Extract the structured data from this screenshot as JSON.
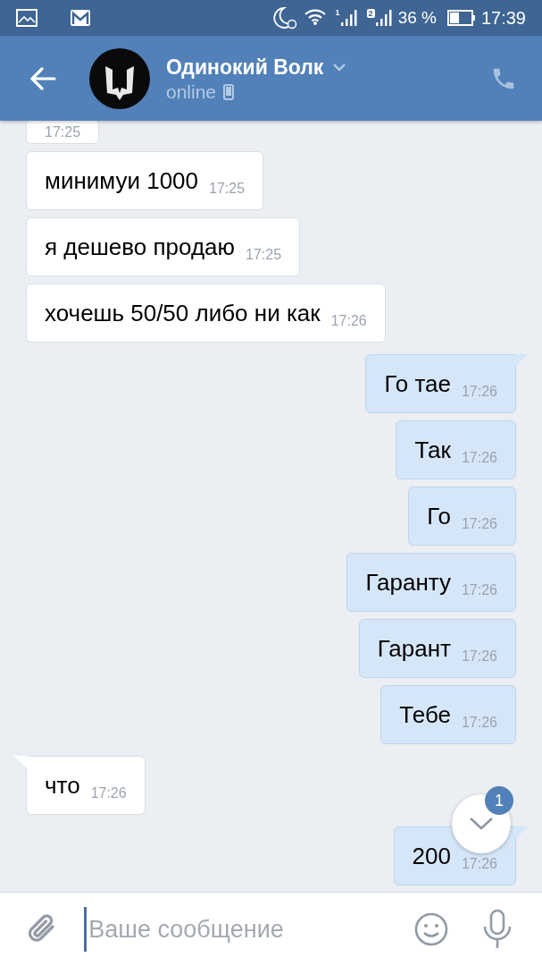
{
  "status_bar": {
    "battery": "36 %",
    "time": "17:39",
    "sim_1": "1",
    "sim_2": "2"
  },
  "header": {
    "name": "Одинокий Волк",
    "status": "online"
  },
  "messages": [
    {
      "kind": "in",
      "time": "17:25",
      "tail": false
    },
    {
      "kind": "in",
      "text": "минимуи 1000",
      "time": "17:25",
      "tail": false
    },
    {
      "kind": "in",
      "text": "я дешево продаю",
      "time": "17:25",
      "tail": false
    },
    {
      "kind": "in",
      "text": "хочешь 50/50 либо ни как",
      "time": "17:26",
      "tail": false
    },
    {
      "kind": "out",
      "text": "Го тае",
      "time": "17:26",
      "tail": true
    },
    {
      "kind": "out",
      "text": "Так",
      "time": "17:26",
      "tail": false
    },
    {
      "kind": "out",
      "text": "Го",
      "time": "17:26",
      "tail": false
    },
    {
      "kind": "out",
      "text": "Гаранту",
      "time": "17:26",
      "tail": false
    },
    {
      "kind": "out",
      "text": "Гарант",
      "time": "17:26",
      "tail": false
    },
    {
      "kind": "out",
      "text": "Тебе",
      "time": "17:26",
      "tail": false
    },
    {
      "kind": "in",
      "text": "что",
      "time": "17:26",
      "tail": true
    },
    {
      "kind": "out",
      "text": "200",
      "time": "17:26",
      "tail": true
    }
  ],
  "scroll_down": {
    "badge": "1"
  },
  "composer": {
    "placeholder": "Ваше сообщение"
  }
}
